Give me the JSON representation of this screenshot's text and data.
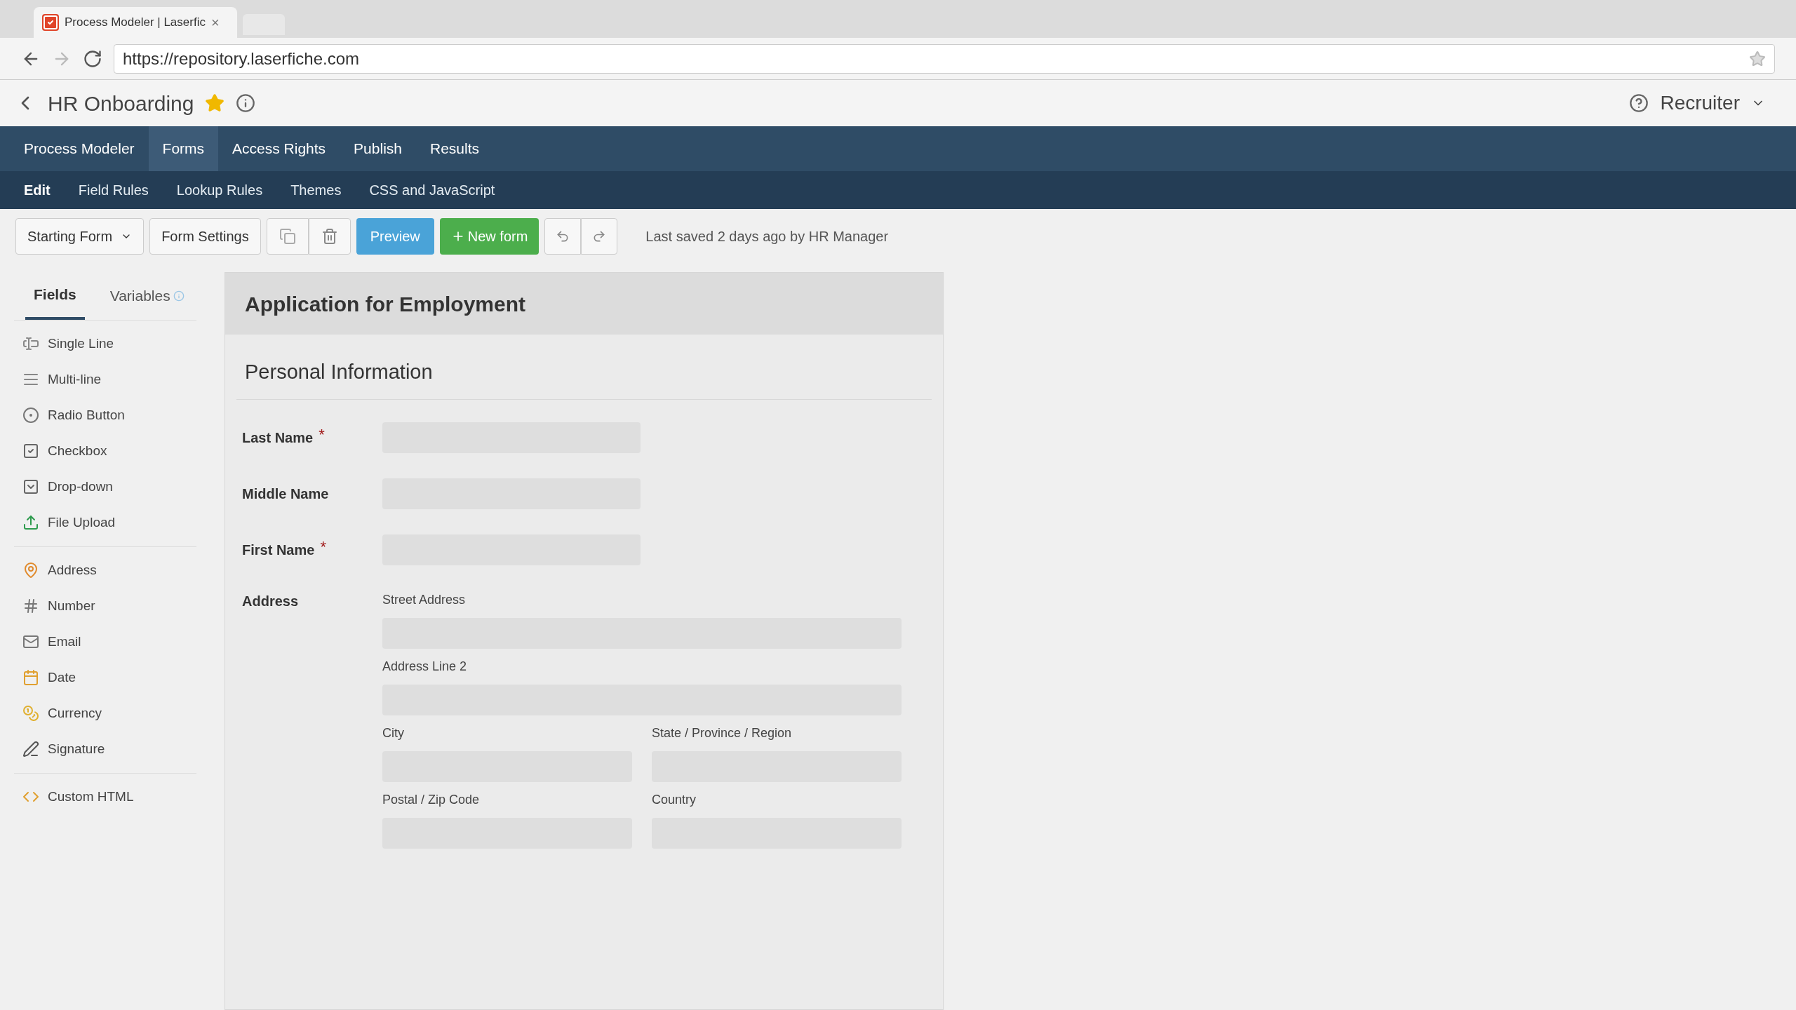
{
  "browser": {
    "tab_title": "Process Modeler | Laserfic",
    "close": "×",
    "url": "https://repository.laserfiche.com"
  },
  "header": {
    "title": "HR Onboarding",
    "favorite": true,
    "user": "Recruiter"
  },
  "nav": [
    {
      "label": "Process Modeler",
      "selected": false
    },
    {
      "label": "Forms",
      "selected": true
    },
    {
      "label": "Access Rights",
      "selected": false
    },
    {
      "label": "Publish",
      "selected": false
    },
    {
      "label": "Results",
      "selected": false
    }
  ],
  "subnav": [
    {
      "label": "Edit",
      "selected": true
    },
    {
      "label": "Field Rules",
      "selected": false
    },
    {
      "label": "Lookup Rules",
      "selected": false
    },
    {
      "label": "Themes",
      "selected": false
    },
    {
      "label": "CSS and JavaScript",
      "selected": false
    }
  ],
  "toolbar": {
    "form_select": "Starting Form",
    "settings": "Form Settings",
    "preview": "Preview",
    "new_form": "New form",
    "status": "Last saved 2 days ago by HR Manager"
  },
  "palette_tabs": [
    {
      "label": "Fields",
      "selected": true
    },
    {
      "label": "Variables",
      "selected": false
    }
  ],
  "palette_groups": [
    [
      "Single Line",
      "Multi-line",
      "Radio Button",
      "Checkbox",
      "Drop-down",
      "File Upload"
    ],
    [
      "Address",
      "Number",
      "Email",
      "Date",
      "Currency",
      "Signature"
    ],
    [
      "Custom HTML"
    ]
  ],
  "form": {
    "title": "Application for Employment",
    "section": "Personal Information",
    "required_mark": "*",
    "fields": [
      {
        "label": "Last Name",
        "required": true
      },
      {
        "label": "Middle Name",
        "required": false
      },
      {
        "label": "First Name",
        "required": true
      }
    ],
    "address": {
      "label": "Address",
      "parts": [
        {
          "label": "Street Address",
          "wide": true
        },
        {
          "label": "Address Line 2",
          "wide": true
        },
        {
          "label": "City",
          "wide": false
        },
        {
          "label": "State / Province / Region",
          "wide": false
        },
        {
          "label": "Postal / Zip Code",
          "wide": false
        },
        {
          "label": "Country",
          "wide": false
        }
      ]
    }
  }
}
